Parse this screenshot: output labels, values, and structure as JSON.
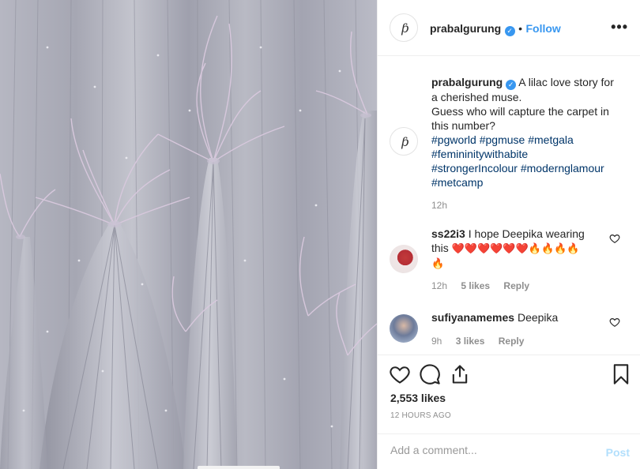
{
  "author": {
    "username": "prabalgurung",
    "monogram": "áƉ",
    "follow_label": "Follow",
    "separator": "•",
    "more_label": "•••"
  },
  "caption": {
    "username": "prabalgurung",
    "text_line1": "A lilac love story for",
    "text_line2": "a cherished muse.",
    "text_line3": "Guess who will capture the carpet in",
    "text_line4": "this number?",
    "hashtags_line1": [
      "#pgworld",
      "#pgmuse",
      "#metgala"
    ],
    "hashtags_line2": [
      "#femininitywithabite"
    ],
    "hashtags_line3": [
      "#strongerIncolour",
      "#modernglamour"
    ],
    "hashtags_line4": [
      "#metcamp"
    ],
    "time": "12h"
  },
  "comments": [
    {
      "username": "ss22i3",
      "text": "I hope Deepika wearing",
      "text2": "this",
      "emoji": "❤️❤️❤️❤️❤️❤️🔥🔥🔥🔥",
      "emoji2": "🔥",
      "time": "12h",
      "likes": "5 likes",
      "reply": "Reply"
    },
    {
      "username": "sufiyanamemes",
      "text": "Deepika",
      "time": "9h",
      "likes": "3 likes",
      "reply": "Reply"
    }
  ],
  "stats": {
    "likes": "2,553 likes",
    "posted": "12 HOURS AGO"
  },
  "composer": {
    "placeholder": "Add a comment...",
    "post_label": "Post"
  },
  "colors": {
    "accent": "#3897f0",
    "hashtag": "#003569",
    "muted": "#8e8e8e",
    "post_disabled": "#b2dffc",
    "fabric": "#b6b7c2",
    "feather": "#d8c8dc"
  },
  "icons": [
    "verified-badge-icon",
    "more-options-icon",
    "heart-icon",
    "comment-icon",
    "share-icon",
    "bookmark-icon"
  ]
}
